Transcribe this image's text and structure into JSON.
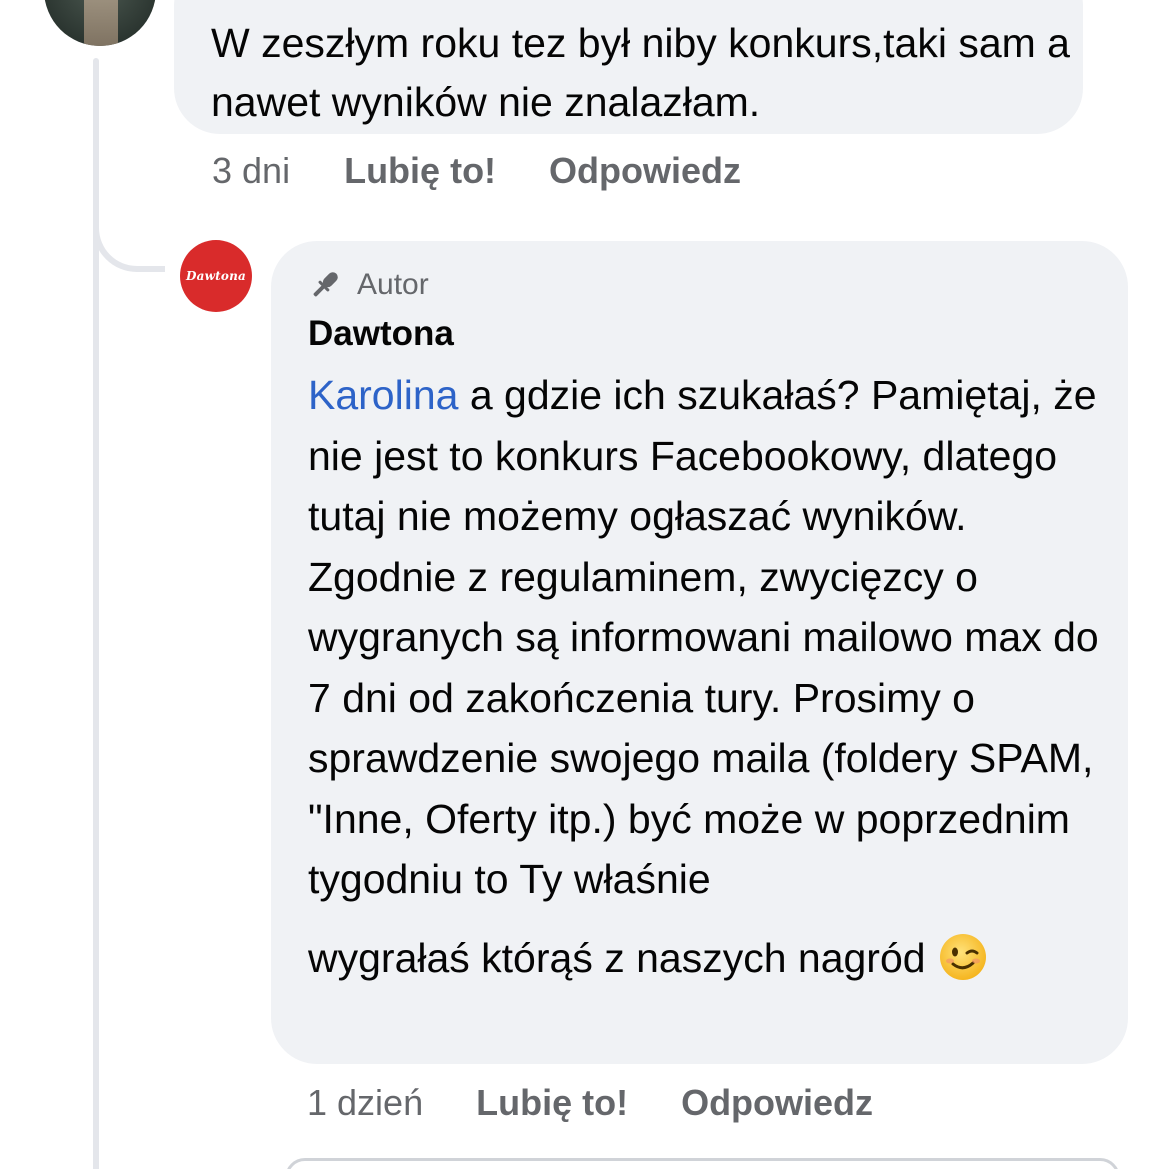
{
  "comment_prev": {
    "text": "W zeszłym roku tez był niby konkurs,taki sam a nawet wyników nie znalazłam.",
    "time": "3 dni",
    "like_label": "Lubię to!",
    "reply_label": "Odpowiedz",
    "avatar_icon": "user-photo-avatar"
  },
  "reply": {
    "avatar_logo_text": "Dawtona",
    "avatar_color": "#d92b2b",
    "author_badge": "Autor",
    "author_badge_icon": "microphone-icon",
    "author_name": "Dawtona",
    "mention": "Karolina",
    "mention_color": "#2d63c8",
    "body_main": " a gdzie ich szukałaś? Pamiętaj, że nie jest to konkurs Facebookowy, dlatego tutaj nie możemy ogłaszać wyników. Zgodnie z regulaminem, zwycięzcy o wygranych są informowani mailowo max do 7 dni od zakończenia tury. Prosimy o sprawdzenie swojego maila (foldery SPAM, \"Inne, Oferty itp.) być może w poprzednim tygodniu to Ty właśnie",
    "body_last": "wygrałaś którąś z naszych nagród",
    "emoji_icon": "winking-face-emoji",
    "time": "1 dzień",
    "like_label": "Lubię to!",
    "reply_label": "Odpowiedz"
  },
  "colors": {
    "bubble_bg": "#f0f2f5",
    "meta_text": "#65676b",
    "thread_line": "#e4e6eb"
  }
}
